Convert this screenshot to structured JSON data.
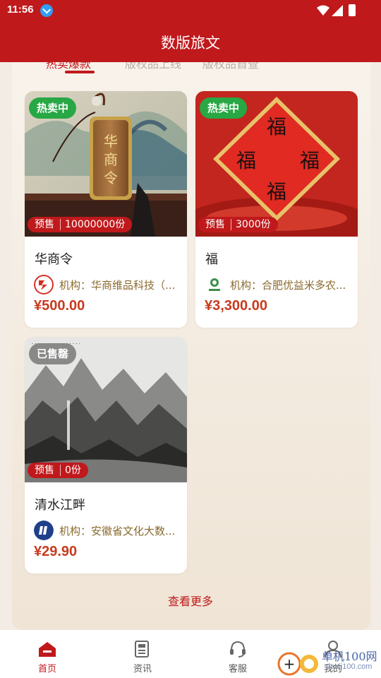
{
  "status_bar": {
    "time": "11:56"
  },
  "header": {
    "title": "数版旅文"
  },
  "tabs": [
    {
      "label": "热卖爆款",
      "active": true
    },
    {
      "label": "版权品上线",
      "active": false
    },
    {
      "label": "版权品首查",
      "active": false
    }
  ],
  "products": [
    {
      "badge": "热卖中",
      "badge_type": "hot",
      "presale_label": "预售",
      "stock": "10000000份",
      "name": "华商令",
      "org": "机构：华商维品科技（...",
      "price": "¥500.00"
    },
    {
      "badge": "热卖中",
      "badge_type": "hot",
      "presale_label": "预售",
      "stock": "3000份",
      "name": "福",
      "org": "机构：合肥优益米多农...",
      "price": "¥3,300.00",
      "image_text": [
        "福",
        "福",
        "福",
        "福"
      ]
    },
    {
      "badge": "已售罄",
      "badge_type": "sold",
      "presale_label": "预售",
      "stock": "0份",
      "name": "清水江畔",
      "org": "机构：安徽省文化大数...",
      "price": "¥29.90"
    }
  ],
  "view_more": "查看更多",
  "bottom_nav": [
    {
      "label": "首页",
      "icon": "home-icon",
      "active": true
    },
    {
      "label": "资讯",
      "icon": "news-icon",
      "active": false
    },
    {
      "label": "客服",
      "icon": "headset-icon",
      "active": false
    },
    {
      "label": "我的",
      "icon": "user-icon",
      "active": false
    }
  ],
  "watermark": {
    "line1": "单机100网",
    "line2": "danji100.com"
  },
  "colors": {
    "primary": "#c0191c",
    "hot_badge": "#27a844",
    "price": "#c93a1f",
    "org_text": "#8a6a2e"
  }
}
